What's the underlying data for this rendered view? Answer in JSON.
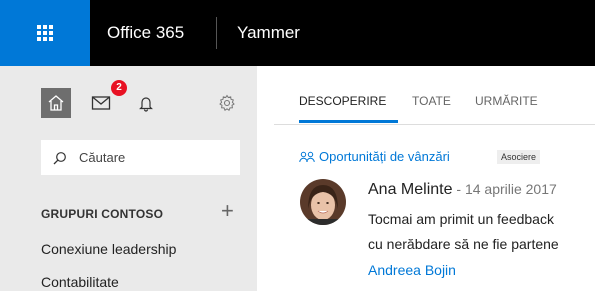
{
  "topbar": {
    "brand": "Office 365",
    "app": "Yammer"
  },
  "sidebar": {
    "notification_count": "2",
    "search_placeholder": "Căutare",
    "groups_header": "GRUPURI CONTOSO",
    "add_symbol": "+",
    "groups": [
      {
        "label": "Conexiune leadership"
      },
      {
        "label": "Contabilitate"
      }
    ]
  },
  "main": {
    "tabs": [
      {
        "label": "DESCOPERIRE",
        "active": true
      },
      {
        "label": "TOATE",
        "active": false
      },
      {
        "label": "URMĂRITE",
        "active": false
      }
    ],
    "post": {
      "group": "Oportunități de vânzări",
      "tag": "Asociere",
      "author": "Ana Melinte",
      "date": " - 14 aprilie 2017",
      "lines": [
        "Tocmai am primit un feedback",
        "cu nerăbdare să ne fie partene"
      ],
      "mention": "Andreea Bojin"
    }
  },
  "colors": {
    "accent": "#0078d7",
    "badge": "#e81123",
    "topbar": "#000000",
    "sidebar": "#eaeaea"
  },
  "icons": [
    "waffle-icon",
    "home-icon",
    "mail-icon",
    "bell-icon",
    "gear-icon",
    "search-icon",
    "group-icon",
    "add-icon"
  ]
}
